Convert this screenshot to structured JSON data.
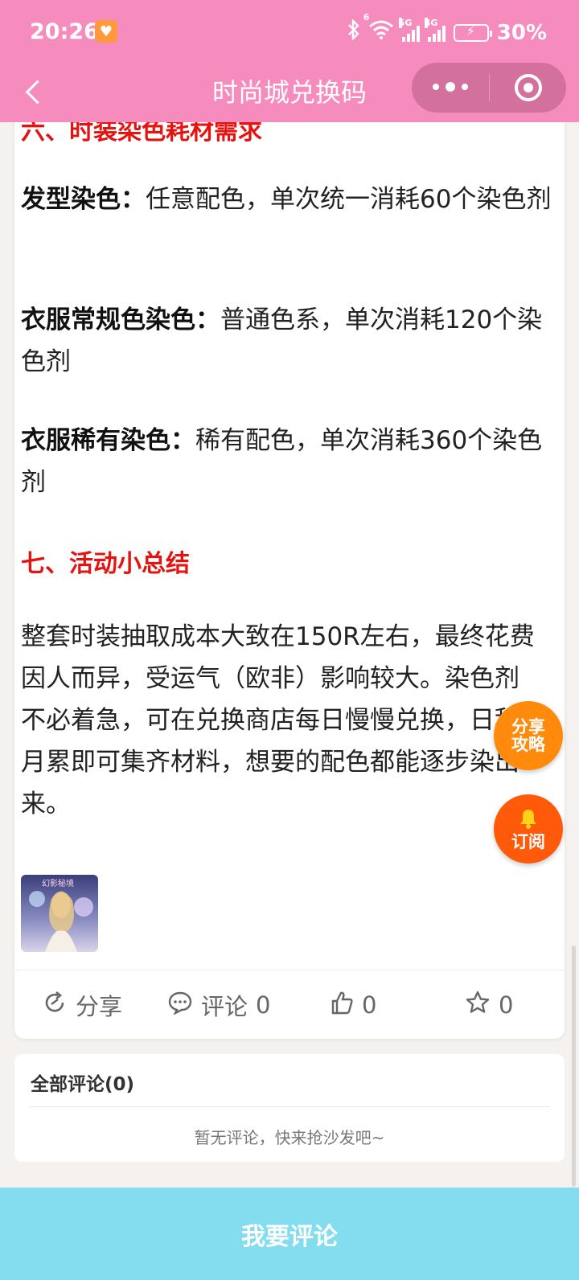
{
  "status_bar": {
    "time": "20:26",
    "network_5g": "5G",
    "network_4g": "4G",
    "wifi_sup": "6",
    "battery": "30%"
  },
  "nav": {
    "title": "时尚城兑换码"
  },
  "article": {
    "partial_heading": "六、时装染色耗材需求",
    "rows": [
      {
        "label": "发型染色：",
        "text": "任意配色，单次统一消耗60个染色剂"
      },
      {
        "label": "衣服常规色染色：",
        "text": "普通色系，单次消耗120个染色剂"
      },
      {
        "label": "衣服稀有染色：",
        "text": "稀有配色，单次消耗360个染色剂"
      }
    ],
    "heading_7": "七、活动小总结",
    "summary": "整套时装抽取成本大致在150R左右，最终花费因人而异，受运气（欧非）影响较大。染色剂不必着急，可在兑换商店每日慢慢兑换，日积月累即可集齐材料，想要的配色都能逐步染出来。",
    "thumb_caption": "幻影秘境"
  },
  "actions": {
    "share_label": "分享",
    "comment_label": "评论",
    "comment_count": "0",
    "like_count": "0",
    "star_count": "0"
  },
  "comments": {
    "title": "全部评论(0)",
    "empty": "暂无评论，快来抢沙发吧~"
  },
  "fab": {
    "share_line1": "分享",
    "share_line2": "攻略",
    "subscribe": "订阅"
  },
  "bottom": {
    "comment_button": "我要评论"
  },
  "colors": {
    "header": "#f58cbd",
    "heading_red": "#e6120f",
    "bottom_button": "#84dcef",
    "fab_share": "#ff8a0c",
    "fab_subscribe": "#ff5a0a"
  }
}
